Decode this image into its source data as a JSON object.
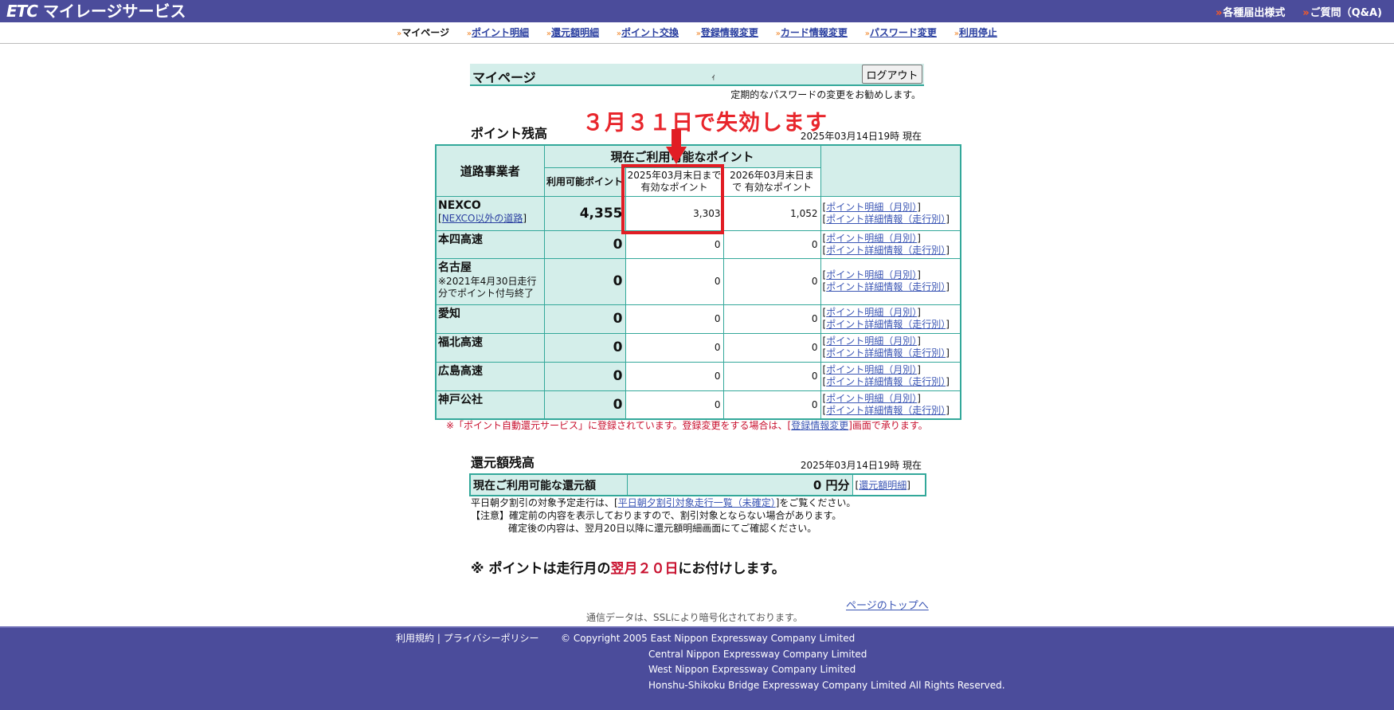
{
  "header": {
    "logo_etc": "ETC",
    "logo_text": "マイレージサービス",
    "links": [
      "各種届出様式",
      "ご質問（Q&A)"
    ]
  },
  "nav": {
    "items": [
      {
        "label": "マイページ",
        "current": true
      },
      {
        "label": "ポイント明細"
      },
      {
        "label": "還元額明細"
      },
      {
        "label": "ポイント交換"
      },
      {
        "label": "登録情報変更"
      },
      {
        "label": "カード情報変更"
      },
      {
        "label": "パスワード変更"
      },
      {
        "label": "利用停止"
      }
    ]
  },
  "mypage": {
    "title": "マイページ",
    "logout_label": "ログアウト",
    "tick": "ｨ",
    "password_notice": "定期的なパスワードの変更をお勧めします。"
  },
  "annotation": {
    "text": "３月３１日で失効します",
    "color": "#e8262c"
  },
  "points": {
    "title": "ポイント残高",
    "as_of": "2025年03月14日19時 現在",
    "headers": {
      "operator": "道路事業者",
      "current": "現在ご利用可能なポイント",
      "available": "利用可能ポイント",
      "expire_2025": "2025年03月末日まで 有効なポイント",
      "expire_2026": "2026年03月末日まで 有効なポイント"
    },
    "link_monthly": "ポイント明細（月別）",
    "link_trip": "ポイント詳細情報（走行別）",
    "rows": [
      {
        "name": "NEXCO",
        "sub": "NEXCO以外の道路",
        "available": "4,355",
        "expire_2025": "3,303",
        "expire_2026": "1,052"
      },
      {
        "name": "本四高速",
        "available": "0",
        "expire_2025": "0",
        "expire_2026": "0"
      },
      {
        "name": "名古屋",
        "note": "※2021年4月30日走行分でポイント付与終了",
        "available": "0",
        "expire_2025": "0",
        "expire_2026": "0"
      },
      {
        "name": "愛知",
        "available": "0",
        "expire_2025": "0",
        "expire_2026": "0"
      },
      {
        "name": "福北高速",
        "available": "0",
        "expire_2025": "0",
        "expire_2026": "0"
      },
      {
        "name": "広島高速",
        "available": "0",
        "expire_2025": "0",
        "expire_2026": "0"
      },
      {
        "name": "神戸公社",
        "available": "0",
        "expire_2025": "0",
        "expire_2026": "0"
      }
    ],
    "auto_notice_pre": "※「ポイント自動還元サービス」に登録されています。登録変更をする場合は、[",
    "auto_notice_link": "登録情報変更",
    "auto_notice_post": "]画面で承ります。"
  },
  "refund": {
    "title": "還元額残高",
    "as_of": "2025年03月14日19時 現在",
    "label": "現在ご利用可能な還元額",
    "amount": "0 円分",
    "link": "還元額明細",
    "note1_pre": "平日朝夕割引の対象予定走行は、[",
    "note1_link": "平日朝夕割引対象走行一覧（未確定）",
    "note1_post": "]をご覧ください。",
    "note2": "【注意】確定前の内容を表示しておりますので、割引対象とならない場合があります。",
    "note3": "確定後の内容は、翌月20日以降に還元額明細画面にてご確認ください。"
  },
  "bonus": {
    "pre": "※ ポイントは走行月の",
    "red": "翌月２０日",
    "post": "にお付けします。"
  },
  "page_top": "ページのトップへ",
  "ssl": "通信データは、SSLにより暗号化されております。",
  "footer": {
    "terms": "利用規約",
    "sep": "|",
    "privacy": "プライバシーポリシー",
    "copyright": [
      "© Copyright 2005 East Nippon Expressway Company Limited",
      "Central Nippon Expressway Company Limited",
      "West Nippon Expressway Company Limited",
      "Honshu-Shikoku Bridge Expressway Company Limited All Rights Reserved."
    ]
  },
  "colors": {
    "header_bg": "#4b4c9b",
    "table_bg": "#d4eeea",
    "table_border": "#33a89a",
    "highlight": "#e11d24"
  }
}
